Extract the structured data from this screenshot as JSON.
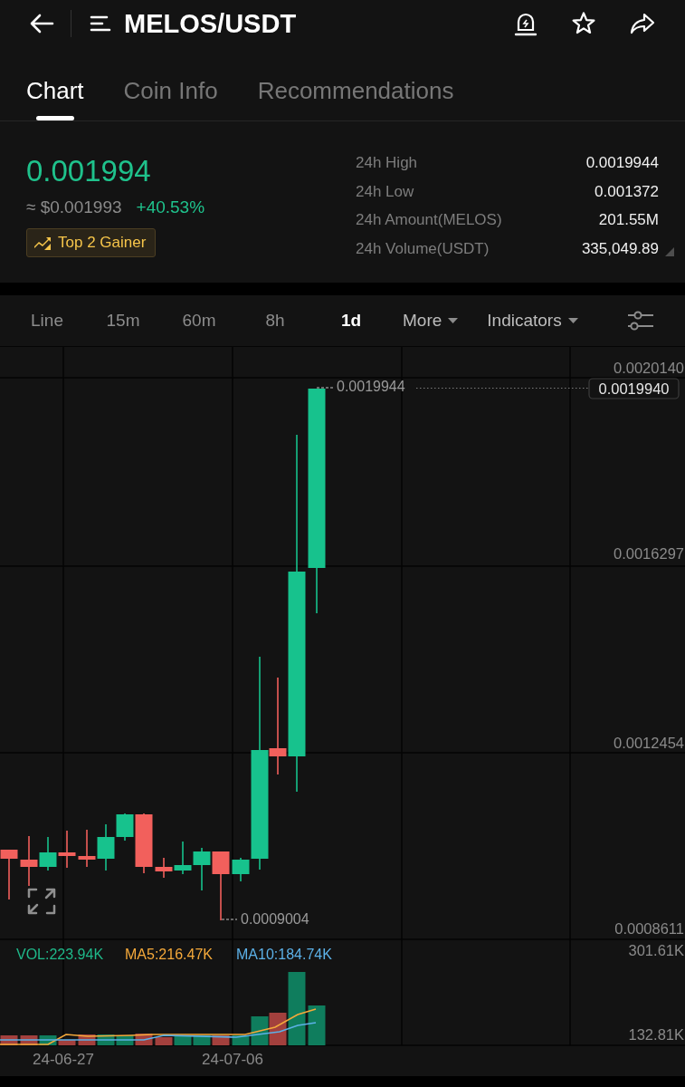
{
  "header": {
    "title": "MELOS/USDT"
  },
  "tabs": [
    {
      "label": "Chart",
      "selected": true
    },
    {
      "label": "Coin Info",
      "selected": false
    },
    {
      "label": "Recommendations",
      "selected": false
    }
  ],
  "ticker": {
    "price": "0.001994",
    "usd_price": "≈ $0.001993",
    "change": "+40.53%",
    "badge": "Top 2 Gainer"
  },
  "stats": [
    {
      "label": "24h High",
      "value": "0.0019944"
    },
    {
      "label": "24h Low",
      "value": "0.001372"
    },
    {
      "label": "24h Amount(MELOS)",
      "value": "201.55M"
    },
    {
      "label": "24h Volume(USDT)",
      "value": "335,049.89"
    }
  ],
  "intervals": [
    {
      "label": "Line",
      "selected": false
    },
    {
      "label": "15m",
      "selected": false
    },
    {
      "label": "60m",
      "selected": false
    },
    {
      "label": "8h",
      "selected": false
    },
    {
      "label": "1d",
      "selected": true
    }
  ],
  "menus": [
    {
      "label": "More"
    },
    {
      "label": "Indicators"
    }
  ],
  "chart": {
    "price_axis": [
      "0.0020140",
      "0.0016297",
      "0.0012454",
      "0.0008611"
    ],
    "current_price": "0.0019940",
    "high_label": "0.0019944",
    "low_label": "0.0009004",
    "indicators": [
      {
        "text": "VOL:223.94K",
        "color": "#1fb98a"
      },
      {
        "text": "MA5:216.47K",
        "color": "#f5a93a"
      },
      {
        "text": "MA10:184.74K",
        "color": "#5cb1e8"
      }
    ],
    "volume_axis": [
      "301.61K",
      "132.81K"
    ],
    "dates": [
      "24-06-27",
      "24-07-06"
    ]
  }
}
